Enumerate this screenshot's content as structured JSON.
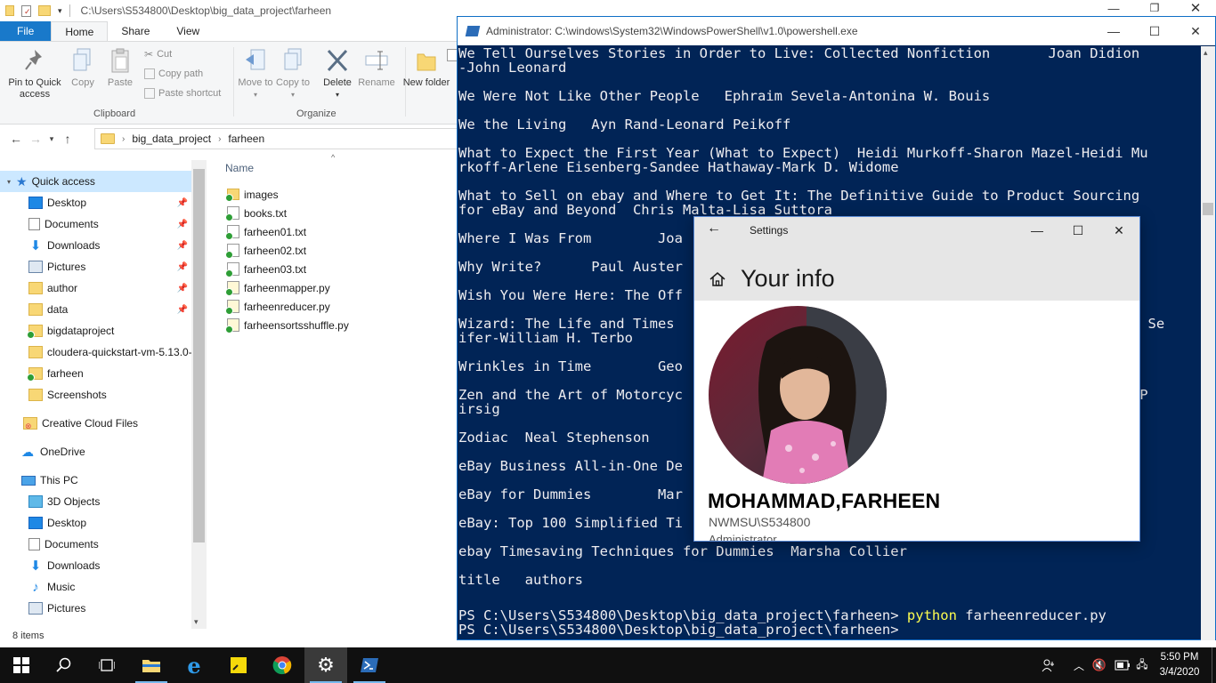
{
  "explorer": {
    "title_path": "C:\\Users\\S534800\\Desktop\\big_data_project\\farheen",
    "tabs": [
      "File",
      "Home",
      "Share",
      "View"
    ],
    "ribbon": {
      "pin_label": "Pin to Quick access",
      "copy_label": "Copy",
      "paste_label": "Paste",
      "cut_label": "Cut",
      "copy_path_label": "Copy path",
      "paste_shortcut_label": "Paste shortcut",
      "clipboard_group": "Clipboard",
      "move_to_label": "Move to",
      "copy_to_label": "Copy to",
      "delete_label": "Delete",
      "rename_label": "Rename",
      "organize_group": "Organize",
      "new_folder_label": "New folder"
    },
    "breadcrumb": [
      "big_data_project",
      "farheen"
    ],
    "nav": {
      "quick_access": "Quick access",
      "items": [
        "Desktop",
        "Documents",
        "Downloads",
        "Pictures",
        "author",
        "data",
        "bigdataproject",
        "cloudera-quickstart-vm-5.13.0-",
        "farheen",
        "Screenshots"
      ],
      "creative_cloud": "Creative Cloud Files",
      "onedrive": "OneDrive",
      "this_pc": "This PC",
      "pc_items": [
        "3D Objects",
        "Desktop",
        "Documents",
        "Downloads",
        "Music",
        "Pictures"
      ]
    },
    "column_name": "Name",
    "files": [
      "images",
      "books.txt",
      "farheen01.txt",
      "farheen02.txt",
      "farheen03.txt",
      "farheenmapper.py",
      "farheenreducer.py",
      "farheensortsshuffle.py"
    ],
    "status": "8 items"
  },
  "powershell": {
    "title": "Administrator: C:\\windows\\System32\\WindowsPowerShell\\v1.0\\powershell.exe",
    "lines": [
      "We Tell Ourselves Stories in Order to Live: Collected Nonfiction       Joan Didion",
      "-John Leonard",
      "",
      "We Were Not Like Other People   Ephraim Sevela-Antonina W. Bouis",
      "",
      "We the Living   Ayn Rand-Leonard Peikoff",
      "",
      "What to Expect the First Year (What to Expect)  Heidi Murkoff-Sharon Mazel-Heidi Mu",
      "rkoff-Arlene Eisenberg-Sandee Hathaway-Mark D. Widome",
      "",
      "What to Sell on ebay and Where to Get It: The Definitive Guide to Product Sourcing",
      "for eBay and Beyond  Chris Malta-Lisa Suttora",
      "",
      "Where I Was From        Joa",
      "",
      "Why Write?      Paul Auster",
      "",
      "Wish You Were Here: The Off",
      "",
      "Wizard: The Life and Times                                                     J.  Se",
      "ifer-William H. Terbo",
      "",
      "Wrinkles in Time        Geo",
      "",
      "Zen and the Art of Motorcyc                                                 rt M. P",
      "irsig",
      "",
      "Zodiac  Neal Stephenson",
      "",
      "eBay Business All-in-One De",
      "",
      "eBay for Dummies        Mar",
      "",
      "eBay: Top 100 Simplified Ti",
      "",
      "ebay Timesaving Techniques for Dummies  Marsha Collier",
      "",
      "title   authors",
      ""
    ],
    "prompt1": "PS C:\\Users\\S534800\\Desktop\\big_data_project\\farheen> ",
    "command": "python",
    "command_arg": " farheenreducer.py",
    "prompt2": "PS C:\\Users\\S534800\\Desktop\\big_data_project\\farheen>"
  },
  "settings": {
    "title": "Settings",
    "heading": "Your info",
    "name": "MOHAMMAD,FARHEEN",
    "account": "NWMSU\\S534800",
    "role": "Administrator"
  },
  "taskbar": {
    "time": "5:50 PM",
    "date": "3/4/2020"
  },
  "colors": {
    "powershell_bg": "#012456",
    "accent": "#1979ca",
    "taskbar": "#101010"
  }
}
